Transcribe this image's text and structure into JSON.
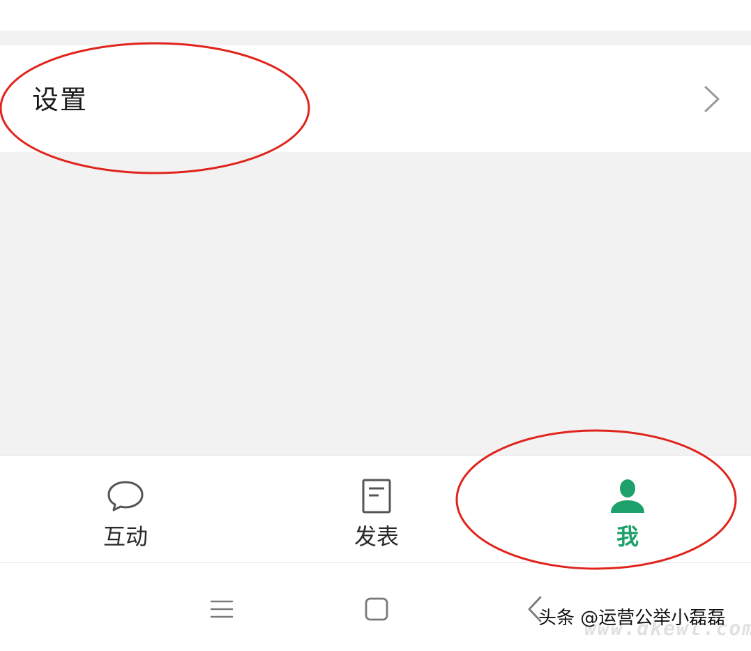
{
  "settings_row": {
    "label": "设置",
    "chevron_icon": "chevron-right-icon"
  },
  "tab_bar": {
    "tabs": [
      {
        "label": "互动",
        "icon": "chat-bubble-icon",
        "active": false
      },
      {
        "label": "发表",
        "icon": "document-icon",
        "active": false
      },
      {
        "label": "我",
        "icon": "person-icon",
        "active": true
      }
    ]
  },
  "nav_bar": {
    "menu_icon": "menu-icon",
    "home_icon": "home-square-icon",
    "back_icon": "back-chevron-icon"
  },
  "watermark": {
    "text": "头条 @运营公举小磊磊",
    "sub_text": "www.dkewl.com"
  },
  "colors": {
    "accent_green": "#1ea06a",
    "annotation_red": "#e0241b",
    "background_gray": "#f2f2f2"
  }
}
